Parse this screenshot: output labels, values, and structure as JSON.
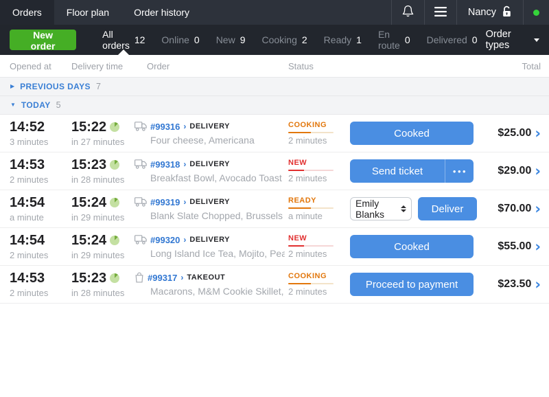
{
  "topbar": {
    "tabs": [
      {
        "label": "Orders",
        "active": true
      },
      {
        "label": "Floor plan",
        "active": false
      },
      {
        "label": "Order history",
        "active": false
      }
    ],
    "user_name": "Nancy",
    "status_dot_color": "#35d33a"
  },
  "filterbar": {
    "new_order": "New order",
    "filters": [
      {
        "label": "All orders",
        "count": "12",
        "active": true
      },
      {
        "label": "Online",
        "count": "0",
        "active": false
      },
      {
        "label": "New",
        "count": "9",
        "active": false
      },
      {
        "label": "Cooking",
        "count": "2",
        "active": false
      },
      {
        "label": "Ready",
        "count": "1",
        "active": false
      },
      {
        "label": "En route",
        "count": "0",
        "active": false
      },
      {
        "label": "Delivered",
        "count": "0",
        "active": false
      }
    ],
    "order_types": "Order types"
  },
  "table": {
    "headers": [
      "Opened at",
      "Delivery time",
      "Order",
      "Status",
      "Total"
    ],
    "sections": {
      "previous": {
        "label": "PREVIOUS DAYS",
        "count": "7"
      },
      "today": {
        "label": "TODAY",
        "count": "5"
      }
    },
    "rows": [
      {
        "opened_time": "14:52",
        "opened_ago": "3 minutes",
        "delivery_time": "15:22",
        "delivery_in": "in 27 minutes",
        "order_icon": "truck",
        "order_no": "#99316",
        "order_type": "DELIVERY",
        "items": "Four cheese, Americana",
        "status": {
          "label": "COOKING",
          "ago": "2 minutes",
          "color": "#e2770c",
          "track": "#f3e3c9",
          "progress": 0.5
        },
        "action": {
          "type": "button",
          "label": "Cooked"
        },
        "total": "$25.00"
      },
      {
        "opened_time": "14:53",
        "opened_ago": "2 minutes",
        "delivery_time": "15:23",
        "delivery_in": "in 28 minutes",
        "order_icon": "truck",
        "order_no": "#99318",
        "order_type": "DELIVERY",
        "items": "Breakfast Bowl, Avocado Toast",
        "status": {
          "label": "NEW",
          "ago": "2 minutes",
          "color": "#e12f2f",
          "track": "#f5d6d6",
          "progress": 0.35
        },
        "action": {
          "type": "split",
          "label": "Send ticket",
          "menu": "•••"
        },
        "total": "$29.00"
      },
      {
        "opened_time": "14:54",
        "opened_ago": "a minute",
        "delivery_time": "15:24",
        "delivery_in": "in 29 minutes",
        "order_icon": "truck",
        "order_no": "#99319",
        "order_type": "DELIVERY",
        "items": "Blank Slate Chopped, Brussels Sp…",
        "status": {
          "label": "READY",
          "ago": "a minute",
          "color": "#e2770c",
          "track": "#f3e3c9",
          "progress": 0.5
        },
        "action": {
          "type": "select_button",
          "select_value": "Emily Blanks",
          "label": "Deliver"
        },
        "total": "$70.00"
      },
      {
        "opened_time": "14:54",
        "opened_ago": "2 minutes",
        "delivery_time": "15:24",
        "delivery_in": "in 29 minutes",
        "order_icon": "truck",
        "order_no": "#99320",
        "order_type": "DELIVERY",
        "items": "Long Island Ice Tea, Mojito, Pear C…",
        "status": {
          "label": "NEW",
          "ago": "2 minutes",
          "color": "#e12f2f",
          "track": "#f5d6d6",
          "progress": 0.35
        },
        "action": {
          "type": "button",
          "label": "Cooked"
        },
        "total": "$55.00"
      },
      {
        "opened_time": "14:53",
        "opened_ago": "2 minutes",
        "delivery_time": "15:23",
        "delivery_in": "in 28 minutes",
        "order_icon": "bag",
        "order_no": "#99317",
        "order_type": "TAKEOUT",
        "items": "Macarons, M&M Cookie Skillet, Co…",
        "status": {
          "label": "COOKING",
          "ago": "2 minutes",
          "color": "#e2770c",
          "track": "#f3e3c9",
          "progress": 0.5
        },
        "action": {
          "type": "button",
          "label": "Proceed to payment"
        },
        "total": "$23.50"
      }
    ]
  },
  "colors": {
    "accent_blue": "#4a8ee2",
    "green": "#45ae25",
    "link_blue": "#3177d2"
  }
}
